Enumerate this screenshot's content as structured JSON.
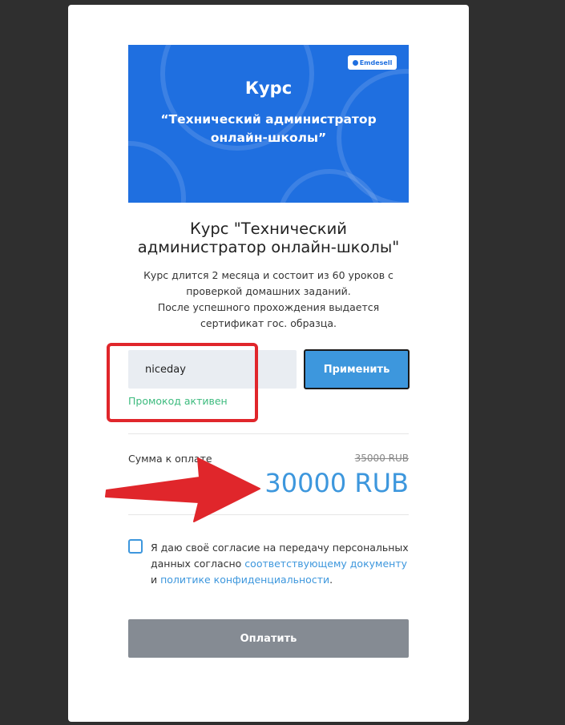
{
  "banner": {
    "logo_text": "Emdesell",
    "title": "Курс",
    "subtitle_line1": "“Технический администратор",
    "subtitle_line2": "онлайн-школы”",
    "background_color": "#1f6fe0"
  },
  "course": {
    "title_line1": "Курс \"Технический",
    "title_line2": "администратор онлайн-школы\"",
    "description_lines": [
      "Курс длится 2 месяца и состоит из 60 уроков с",
      "проверкой домашних заданий.",
      "После успешного прохождения выдается",
      "сертификат гос. образца."
    ]
  },
  "promo": {
    "value": "niceday",
    "apply_label": "Применить",
    "status": "Промокод активен",
    "status_color": "#3dbb7e"
  },
  "payment": {
    "sum_label": "Сумма к оплате",
    "old_price": "35000 RUB",
    "new_price": "30000 RUB",
    "accent_color": "#3d97dd"
  },
  "consent": {
    "text_part1": "Я даю своё согласие на передачу персональных данных согласно ",
    "link1": "соответствующему документу",
    "text_part2": " и ",
    "link2": "политике конфиденциальности",
    "text_part3": "."
  },
  "pay_button": {
    "label": "Оплатить"
  },
  "annotations": {
    "highlight_color": "#e0262b",
    "arrow_icon": "red-arrow-icon"
  }
}
